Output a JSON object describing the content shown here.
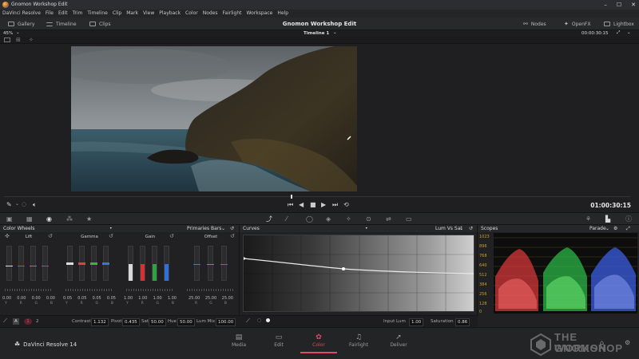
{
  "window": {
    "title": "Gnomon Workshop Edit",
    "controls": [
      "–",
      "☐",
      "✕"
    ]
  },
  "menu": [
    "DaVinci Resolve",
    "File",
    "Edit",
    "Trim",
    "Timeline",
    "Clip",
    "Mark",
    "View",
    "Playback",
    "Color",
    "Nodes",
    "Fairlight",
    "Workspace",
    "Help"
  ],
  "toolbar": {
    "gallery": "Gallery",
    "timeline": "Timeline",
    "clips": "Clips",
    "project_title": "Gnomon Workshop Edit",
    "nodes": "Nodes",
    "openfx": "OpenFX",
    "lightbox": "Lightbox"
  },
  "viewer": {
    "zoom": "45%",
    "timeline_name": "Timeline 1",
    "header_timecode": "00:00:30:15",
    "timecode": "01:00:30:15"
  },
  "wheels": {
    "title": "Color Wheels",
    "mode": "Primaries Bars",
    "items": [
      {
        "label": "Lift",
        "vals": [
          "0.00",
          "0.00",
          "0.00",
          "0.00"
        ]
      },
      {
        "label": "Gamma",
        "vals": [
          "0.05",
          "0.05",
          "0.05",
          "0.05"
        ]
      },
      {
        "label": "Gain",
        "vals": [
          "1.00",
          "1.00",
          "1.00",
          "1.00"
        ]
      },
      {
        "label": "Offset",
        "vals": [
          "25.00",
          "25.00",
          "25.00"
        ]
      }
    ],
    "channel_labels": [
      "Y",
      "R",
      "G",
      "B"
    ],
    "footer": {
      "page_a": "A",
      "page_1": "1",
      "page_2": "2",
      "contrast_label": "Contrast",
      "contrast": "1.132",
      "pivot_label": "Pivot",
      "pivot": "0.435",
      "sat_label": "Sat",
      "sat": "50.00",
      "hue_label": "Hue",
      "hue": "50.00",
      "lummix_label": "Lum Mix",
      "lummix": "100.00"
    }
  },
  "curves": {
    "title": "Curves",
    "mode": "Lum Vs Sat",
    "input_lum_label": "Input Lum",
    "input_lum": "1.00",
    "saturation_label": "Saturation",
    "saturation": "0.86"
  },
  "scopes": {
    "title": "Scopes",
    "mode": "Parade",
    "scale": [
      "1023",
      "896",
      "768",
      "640",
      "512",
      "384",
      "256",
      "128",
      "0"
    ]
  },
  "pages": [
    {
      "label": "Media",
      "icon": "▤"
    },
    {
      "label": "Edit",
      "icon": "▭"
    },
    {
      "label": "Color",
      "icon": "✿"
    },
    {
      "label": "Fairlight",
      "icon": "♫"
    },
    {
      "label": "Deliver",
      "icon": "➚"
    }
  ],
  "brand": "DaVinci Resolve 14",
  "watermark": {
    "line1": "THE GNOMON",
    "line2": "WORKSHOP"
  },
  "colors": {
    "accent": "#e04a66",
    "panel": "#212123",
    "scope_scale": "#c9a020"
  }
}
